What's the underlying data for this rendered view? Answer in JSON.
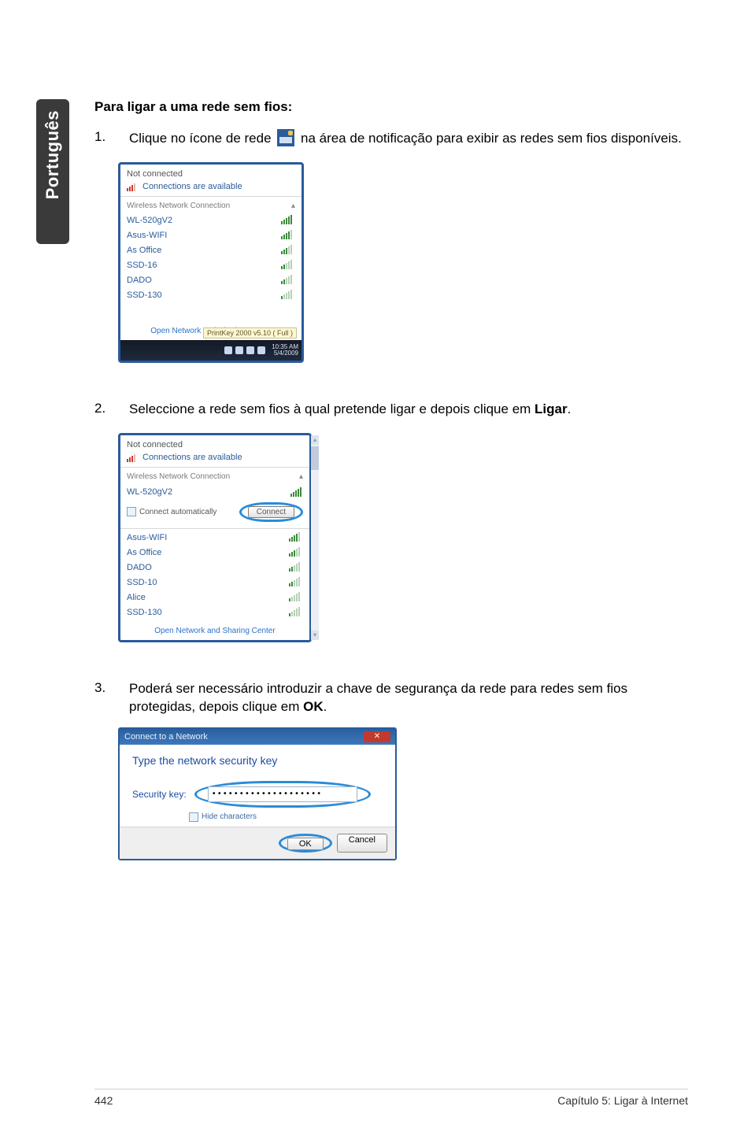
{
  "side_tab": "Português",
  "heading": "Para ligar a uma rede sem fios:",
  "step1": {
    "num": "1.",
    "text_a": "Clique no ícone de rede ",
    "text_b": " na área de notificação para exibir as redes sem fios disponíveis."
  },
  "flyout1": {
    "status": "Not connected",
    "avail": "Connections are available",
    "list_header": "Wireless Network Connection",
    "networks": [
      "WL-520gV2",
      "Asus-WIFI",
      "As Office",
      "SSD-16",
      "DADO",
      "SSD-130"
    ],
    "footer": "Open Network and Sharing Center",
    "tooltip": "PrintKey 2000 v5.10 ( Full )",
    "time": "10:35 AM",
    "date": "5/4/2009"
  },
  "step2": {
    "num": "2.",
    "text_a": "Seleccione a rede sem fios à qual pretende ligar e depois clique em ",
    "bold": "Ligar",
    "text_b": "."
  },
  "flyout2": {
    "status": "Not connected",
    "avail": "Connections are available",
    "list_header": "Wireless Network Connection",
    "selected": "WL-520gV2",
    "auto_label": "Connect automatically",
    "connect_btn": "Connect",
    "networks": [
      "Asus-WIFI",
      "As Office",
      "DADO",
      "SSD-10",
      "Alice",
      "SSD-130"
    ],
    "footer": "Open Network and Sharing Center"
  },
  "step3": {
    "num": "3.",
    "text_a": "Poderá ser necessário introduzir a chave de segurança da rede para redes sem fios protegidas, depois clique em ",
    "bold": "OK",
    "text_b": "."
  },
  "dialog": {
    "title": "Connect to a Network",
    "prompt": "Type the network security key",
    "label": "Security key:",
    "mask": "••••••••••••••••••••",
    "hide": "Hide characters",
    "ok": "OK",
    "cancel": "Cancel"
  },
  "footer": {
    "page": "442",
    "chapter": "Capítulo 5: Ligar à Internet"
  }
}
